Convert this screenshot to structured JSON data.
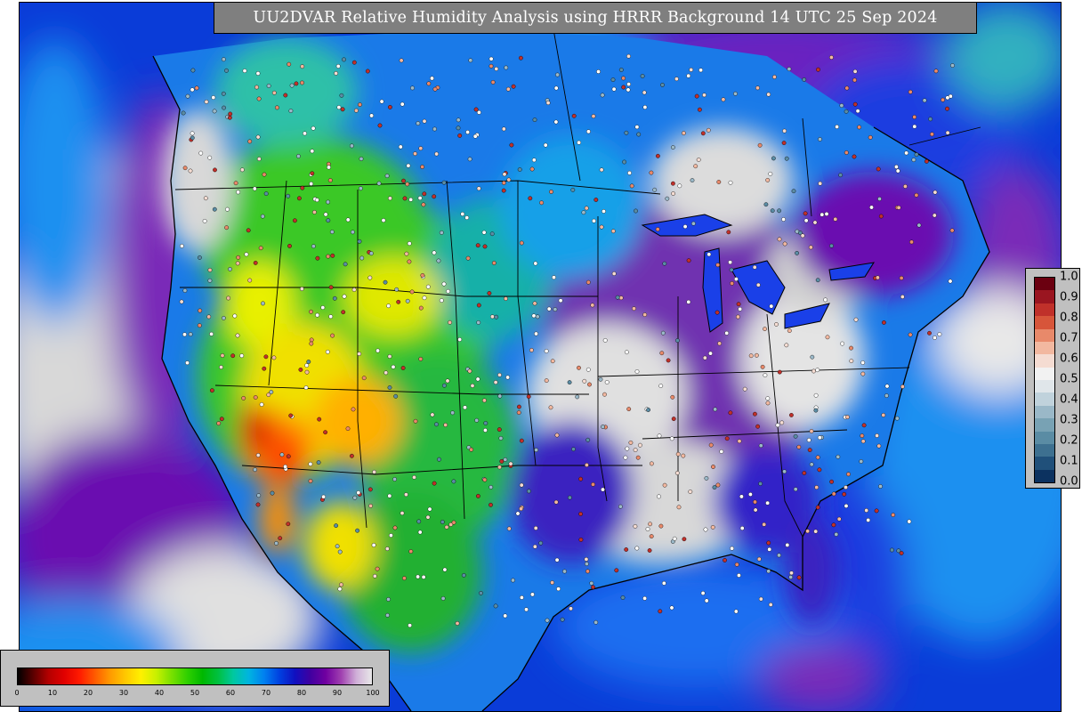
{
  "title": "UU2DVAR Relative Humidity Analysis using HRRR Background 14 UTC 25 Sep 2024",
  "field_colorbar": {
    "ticks": [
      "0",
      "10",
      "20",
      "30",
      "40",
      "50",
      "60",
      "70",
      "80",
      "90",
      "100"
    ],
    "colors": [
      "#000000",
      "#5a0000",
      "#b40000",
      "#e00000",
      "#ff1a00",
      "#ff5a00",
      "#ff9a00",
      "#ffc800",
      "#fff000",
      "#c8f000",
      "#78e000",
      "#30d000",
      "#00b800",
      "#00c040",
      "#00c8a0",
      "#00b4e0",
      "#0080f0",
      "#0040e0",
      "#1010c0",
      "#4000a0",
      "#7000a0",
      "#a040b0",
      "#d0b0d8",
      "#e8e8e8"
    ]
  },
  "obs_colorbar": {
    "ticks": [
      "1.0",
      "0.9",
      "0.8",
      "0.7",
      "0.6",
      "0.5",
      "0.4",
      "0.3",
      "0.2",
      "0.1",
      "0.0"
    ],
    "colors": [
      "#6b0010",
      "#9a1520",
      "#c0302a",
      "#d7553a",
      "#e8896a",
      "#f2b8a0",
      "#f5dcd2",
      "#f2f2f2",
      "#e0e6ea",
      "#c0d2dc",
      "#9ab8c8",
      "#78a2b4",
      "#5a8ca4",
      "#3d7090",
      "#20507a",
      "#0c3260"
    ]
  },
  "colors": {
    "ocean": "#0a3cd8",
    "land_dry": "#3ac828",
    "land_very_dry": "#ff8a00",
    "land_moist": "#1a7ae8",
    "saturated": "#c8c8c8",
    "purple": "#6a10b0",
    "title_bg": "#7f7f7f",
    "panel_bg": "#c0c0c0"
  }
}
